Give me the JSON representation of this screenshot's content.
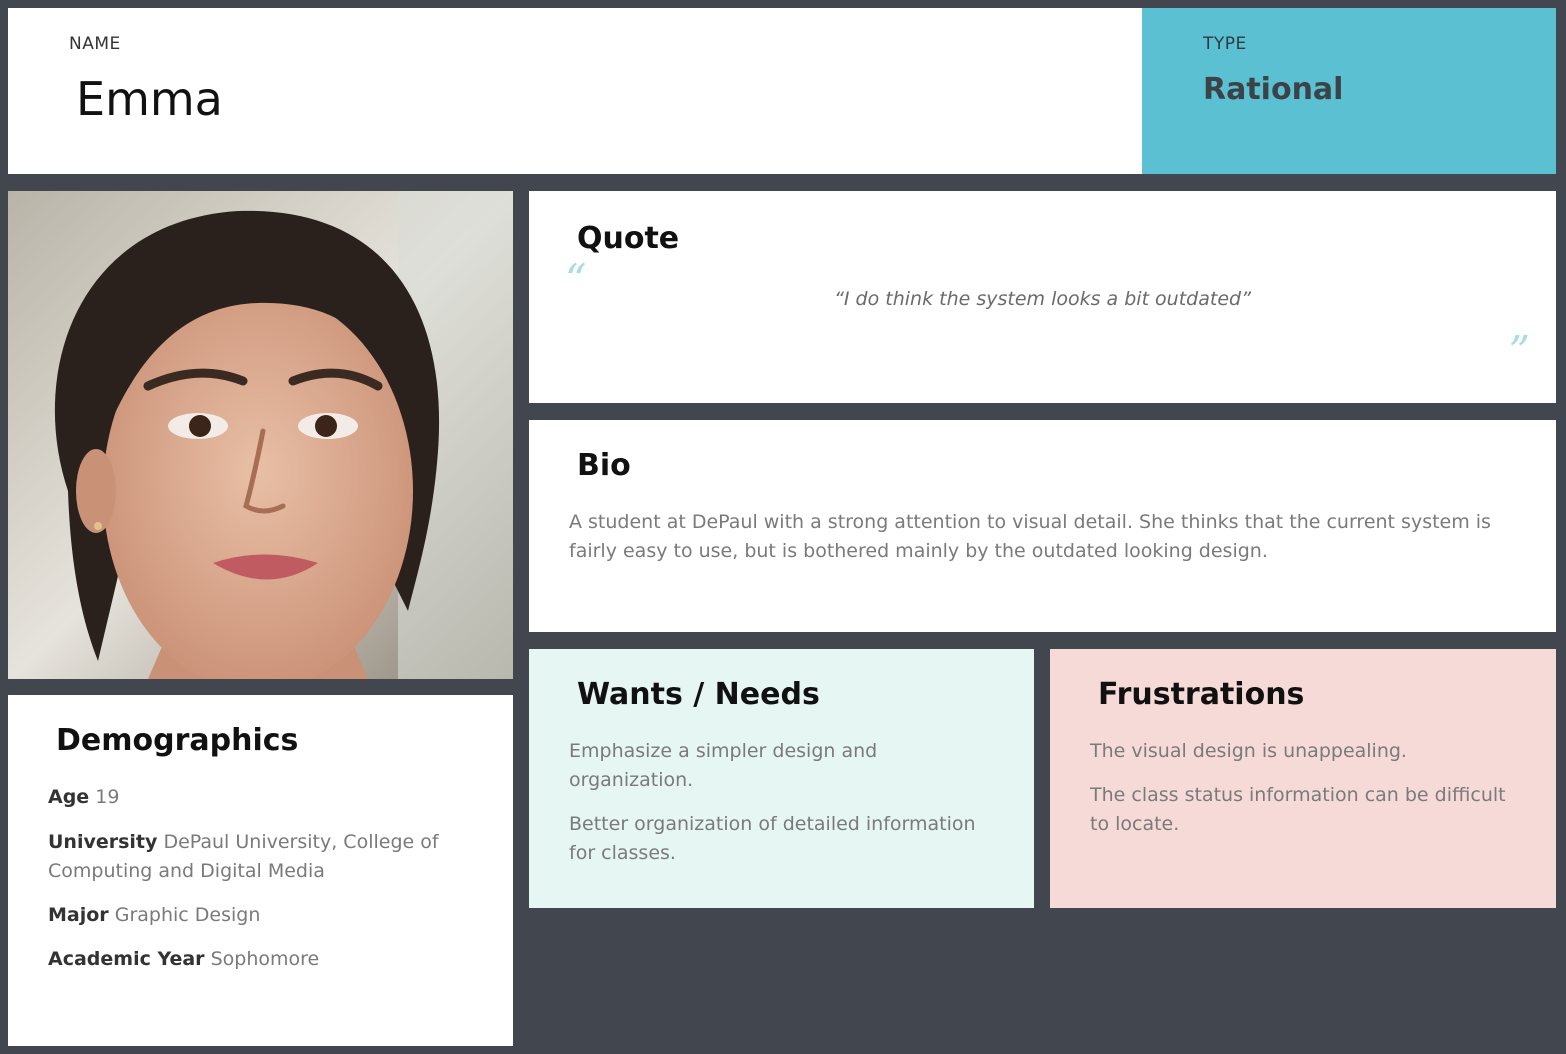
{
  "header": {
    "name_label": "NAME",
    "name": "Emma",
    "type_label": "TYPE",
    "type": "Rational"
  },
  "photo": {
    "alt": "Portrait of Emma"
  },
  "quote": {
    "title": "Quote",
    "open_mark": "“",
    "text": "“I do think the system looks a bit outdated”",
    "close_mark": "”"
  },
  "bio": {
    "title": "Bio",
    "text": "A student at DePaul with a strong attention to visual detail. She thinks that the current system is fairly easy to use, but is bothered mainly by the outdated looking design."
  },
  "demographics": {
    "title": "Demographics",
    "items": [
      {
        "key": "Age",
        "value": "19"
      },
      {
        "key": "University",
        "value": "DePaul University, College of Computing and Digital Media"
      },
      {
        "key": "Major",
        "value": "Graphic Design"
      },
      {
        "key": "Academic Year",
        "value": "Sophomore"
      }
    ]
  },
  "wants": {
    "title": "Wants / Needs",
    "items": [
      "Emphasize a simpler design and organization.",
      "Better organization of detailed information for classes."
    ]
  },
  "frustrations": {
    "title": "Frustrations",
    "items": [
      "The visual design is unappealing.",
      "The class status information can be difficult to locate."
    ]
  },
  "colors": {
    "background": "#42464e",
    "type_accent": "#5bc0d1",
    "wants_bg": "#e6f6f2",
    "frustrations_bg": "#f6dad7",
    "quote_mark": "#a9dbe6"
  }
}
